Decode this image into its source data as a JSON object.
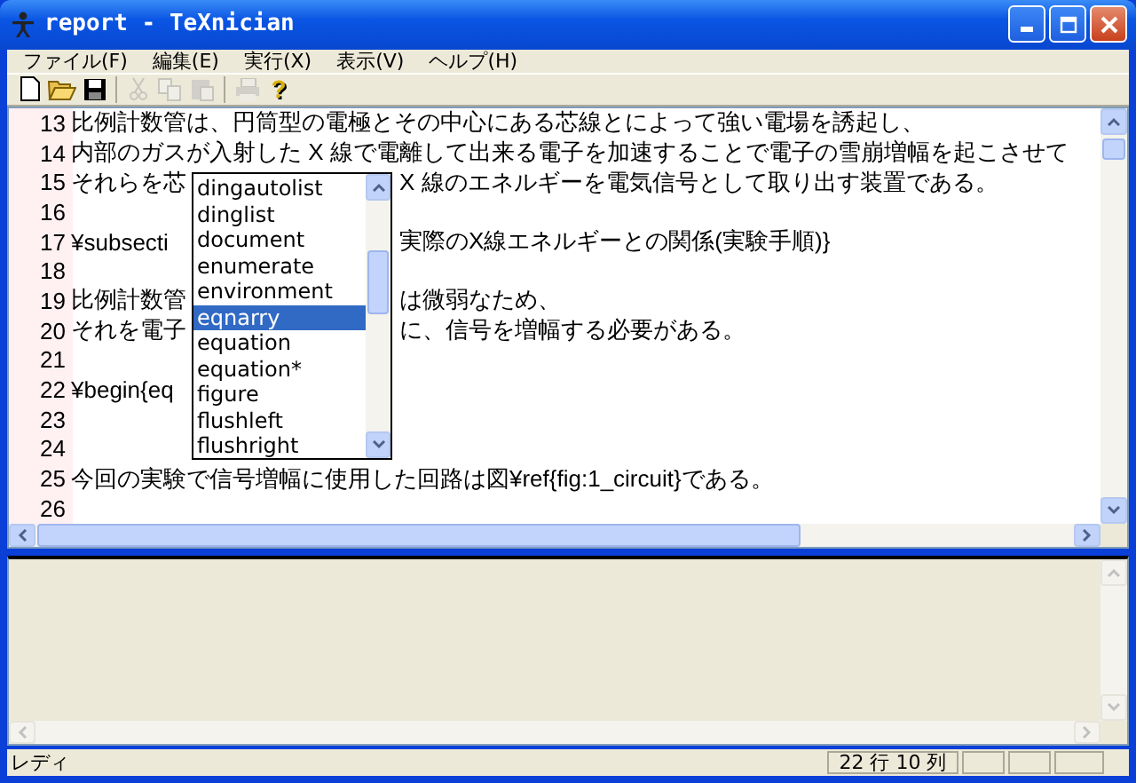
{
  "window": {
    "title": "report - TeXnician"
  },
  "menu": [
    "ファイル(F)",
    "編集(E)",
    "実行(X)",
    "表示(V)",
    "ヘルプ(H)"
  ],
  "toolbar": [
    {
      "kind": "new",
      "disabled": false
    },
    {
      "kind": "open",
      "disabled": false
    },
    {
      "kind": "save",
      "disabled": false
    },
    {
      "kind": "separator"
    },
    {
      "kind": "cut",
      "disabled": true
    },
    {
      "kind": "copy",
      "disabled": true
    },
    {
      "kind": "paste",
      "disabled": true
    },
    {
      "kind": "separator"
    },
    {
      "kind": "print",
      "disabled": true
    },
    {
      "kind": "help",
      "disabled": false,
      "label": "?"
    }
  ],
  "editor": {
    "lines": [
      {
        "number": "13",
        "text": "比例計数管は、円筒型の電極とその中心にある芯線とによって強い電場を誘起し、"
      },
      {
        "number": "14",
        "text": "内部のガスが入射した X 線で電離して出来る電子を加速することで電子の雪崩増幅を起こさせて"
      },
      {
        "number": "15",
        "text": "それらを芯",
        "text_after": "X 線のエネルギーを電気信号として取り出す装置である。"
      },
      {
        "number": "16"
      },
      {
        "number": "17",
        "text": "¥subsecti",
        "text_after": "実際のX線エネルギーとの関係(実験手順)}"
      },
      {
        "number": "18"
      },
      {
        "number": "19",
        "text": "比例計数管",
        "text_after": "は微弱なため、"
      },
      {
        "number": "20",
        "text": "それを電子",
        "text_after": "に、信号を増幅する必要がある。"
      },
      {
        "number": "21"
      },
      {
        "number": "22",
        "text": "¥begin{eq"
      },
      {
        "number": "23"
      },
      {
        "number": "24"
      },
      {
        "number": "25",
        "text": "今回の実験で信号増幅に使用した回路は図¥ref{fig:1_circuit}である。"
      },
      {
        "number": "26"
      }
    ],
    "completion": [
      {
        "label": "dingautolist",
        "selected": false
      },
      {
        "label": "dinglist",
        "selected": false
      },
      {
        "label": "document",
        "selected": false
      },
      {
        "label": "enumerate",
        "selected": false
      },
      {
        "label": "environment",
        "selected": false
      },
      {
        "label": "eqnarry",
        "selected": true
      },
      {
        "label": "equation",
        "selected": false
      },
      {
        "label": "equation*",
        "selected": false
      },
      {
        "label": "figure",
        "selected": false
      },
      {
        "label": "flushleft",
        "selected": false
      },
      {
        "label": "flushright",
        "selected": false
      }
    ]
  },
  "status_bar": {
    "message": "レディ",
    "position": "22 行  10 列"
  }
}
